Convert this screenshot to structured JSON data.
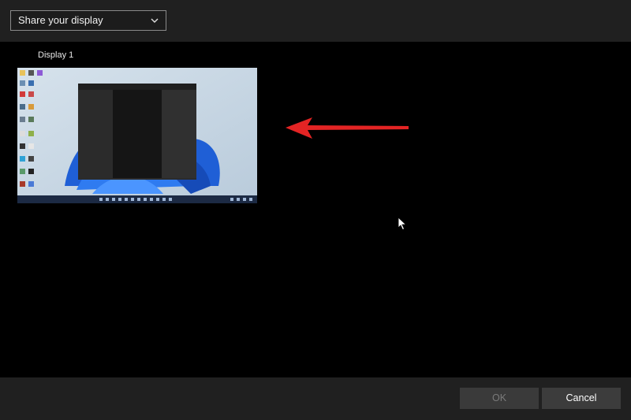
{
  "header": {
    "share_select": {
      "value": "Share your display",
      "icon": "chevron-down-icon"
    }
  },
  "displays": [
    {
      "label": "Display 1",
      "thumbnail": "desktop-preview"
    }
  ],
  "footer": {
    "ok_label": "OK",
    "cancel_label": "Cancel"
  },
  "colors": {
    "arrow": "#e32424",
    "button_disabled_text": "#7a7a7a",
    "panel": "#202020"
  }
}
